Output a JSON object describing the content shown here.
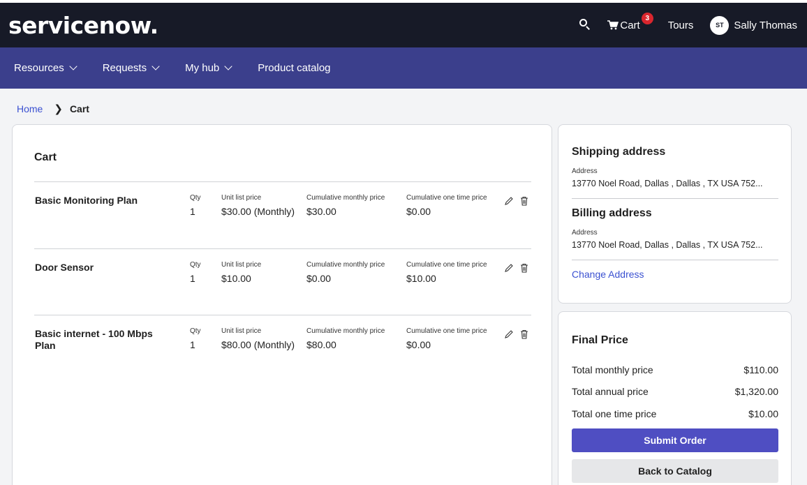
{
  "header": {
    "logo": "servicenow.",
    "cart_label": "Cart",
    "cart_count": "3",
    "tours_label": "Tours",
    "user_initials": "ST",
    "user_name": "Sally Thomas"
  },
  "nav": {
    "items": [
      {
        "label": "Resources",
        "dropdown": true
      },
      {
        "label": "Requests",
        "dropdown": true
      },
      {
        "label": "My hub",
        "dropdown": true
      },
      {
        "label": "Product catalog",
        "dropdown": false
      }
    ]
  },
  "breadcrumb": {
    "home": "Home",
    "current": "Cart"
  },
  "cart": {
    "title": "Cart",
    "columns": {
      "qty": "Qty",
      "unit": "Unit list price",
      "monthly": "Cumulative monthly price",
      "once": "Cumulative one time price"
    },
    "items": [
      {
        "name": "Basic Monitoring Plan",
        "qty": "1",
        "unit": "$30.00 (Monthly)",
        "monthly": "$30.00",
        "once": "$0.00"
      },
      {
        "name": "Door Sensor",
        "qty": "1",
        "unit": "$10.00",
        "monthly": "$0.00",
        "once": "$10.00"
      },
      {
        "name": "Basic internet - 100 Mbps Plan",
        "qty": "1",
        "unit": "$80.00 (Monthly)",
        "monthly": "$80.00",
        "once": "$0.00"
      }
    ]
  },
  "shipping": {
    "title": "Shipping address",
    "label": "Address",
    "value": "13770 Noel Road, Dallas , Dallas , TX USA 752..."
  },
  "billing": {
    "title": "Billing address",
    "label": "Address",
    "value": "13770 Noel Road, Dallas , Dallas , TX USA 752..."
  },
  "change_address": "Change Address",
  "final_price": {
    "title": "Final Price",
    "rows": [
      {
        "label": "Total monthly price",
        "value": "$110.00"
      },
      {
        "label": "Total annual price",
        "value": "$1,320.00"
      },
      {
        "label": "Total one time price",
        "value": "$10.00"
      }
    ],
    "submit_label": "Submit Order",
    "back_label": "Back to Catalog"
  },
  "colors": {
    "topbar": "#171a27",
    "navbar": "#3b3f8c",
    "primary_button": "#4f4ec2",
    "link": "#3b51d1",
    "badge": "#d9262e"
  }
}
